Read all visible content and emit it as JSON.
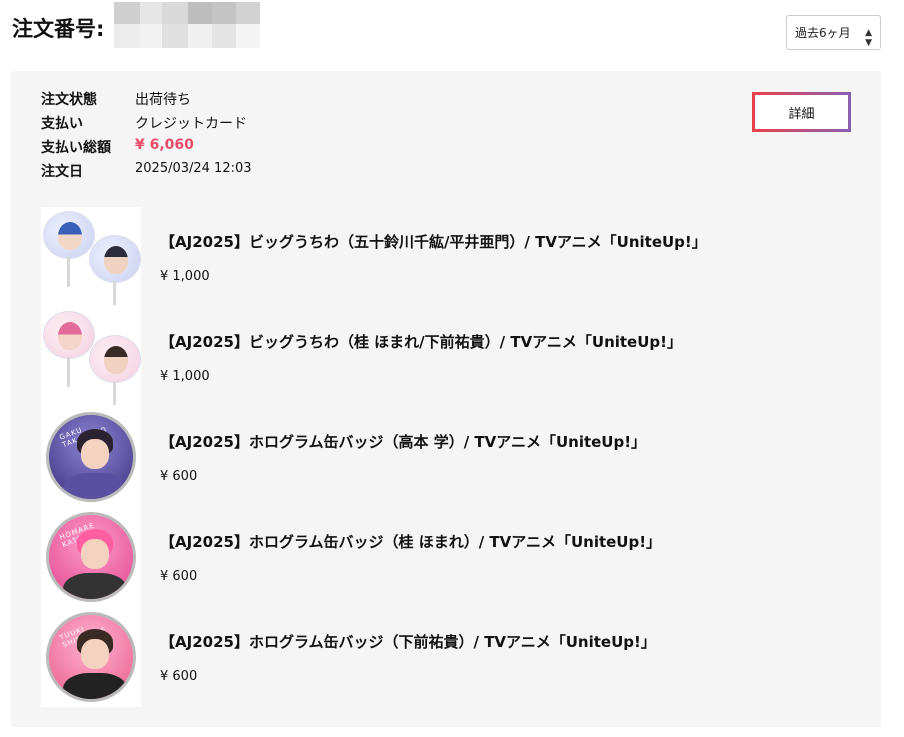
{
  "header": {
    "title": "注文番号:",
    "period_select": "過去6ヶ月"
  },
  "order": {
    "status_label": "注文状態",
    "status_value": "出荷待ち",
    "payment_label": "支払い",
    "payment_value": "クレジットカード",
    "total_label": "支払い総額",
    "total_value": "¥ 6,060",
    "date_label": "注文日",
    "date_value": "2025/03/24 12:03",
    "detail_button": "詳細"
  },
  "items": [
    {
      "name": "【AJ2025】ビッグうちわ（五十鈴川千紘/平井亜門）/ TVアニメ「UniteUp!」",
      "price": "¥ 1,000"
    },
    {
      "name": "【AJ2025】ビッグうちわ（桂 ほまれ/下前祐貴）/ TVアニメ「UniteUp!」",
      "price": "¥ 1,000"
    },
    {
      "name": "【AJ2025】ホログラム缶バッジ（高本 学）/ TVアニメ「UniteUp!」",
      "price": "¥ 600"
    },
    {
      "name": "【AJ2025】ホログラム缶バッジ（桂 ほまれ）/ TVアニメ「UniteUp!」",
      "price": "¥ 600"
    },
    {
      "name": "【AJ2025】ホログラム缶バッジ（下前祐貴）/ TVアニメ「UniteUp!」",
      "price": "¥ 600"
    }
  ],
  "badge_texts": [
    "GAKU TAKAMOTO",
    "HOMARE KATSURA",
    "YUUKI SHIMOMAE"
  ],
  "colors": {
    "panel_bg": "#f5f5f5",
    "price_accent": "#e84a6a",
    "button_gradient_start": "#e8404a",
    "button_gradient_end": "#8a5fb0"
  }
}
